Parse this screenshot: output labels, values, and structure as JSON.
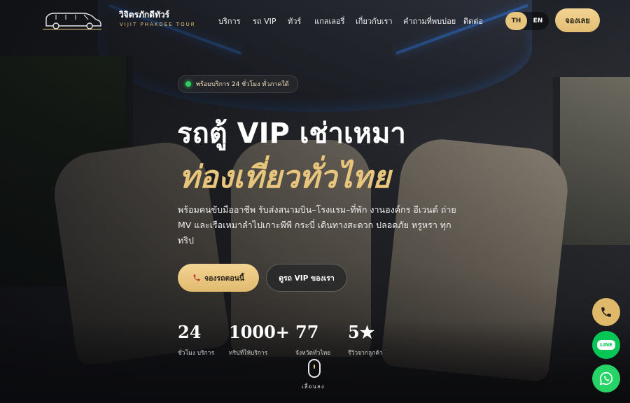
{
  "brand": {
    "name": "วิจิตรภักดีทัวร์",
    "tagline": "VIJIT PHAKDEE TOUR",
    "accent": "#e8c57c"
  },
  "nav": {
    "items": [
      "บริการ",
      "รถ VIP",
      "ทัวร์",
      "แกลเลอรี่",
      "เกี่ยวกับเรา",
      "คำถามที่พบบ่อย",
      "ติดต่อ"
    ]
  },
  "lang": {
    "th": "TH",
    "en": "EN",
    "selected": "TH"
  },
  "header": {
    "book_label": "จองเลย"
  },
  "hero": {
    "badge": "พร้อมบริการ 24 ชั่วโมง ทั่วภาคใต้",
    "title_line1": "รถตู้ VIP เช่าเหมา",
    "title_line2": "ท่องเที่ยวทั่วไทย",
    "description": "พร้อมคนขับมืออาชีพ รับส่งสนามบิน–โรงแรม–ที่พัก งานองค์กร อีเวนต์ ถ่าย MV และเรือเหมาลำไปเกาะพีพี กระบี่ เดินทางสะดวก ปลอดภัย หรูหรา ทุกทริป",
    "primary_button": "จองรถตอนนี้",
    "secondary_button": "ดูรถ VIP ของเรา"
  },
  "stats": [
    {
      "value": "24",
      "label": "ชั่วโมง บริการ"
    },
    {
      "value": "1000+",
      "label": "ทริปที่ให้บริการ"
    },
    {
      "value": "77",
      "label": "จังหวัดทั่วไทย"
    },
    {
      "value": "5★",
      "label": "รีวิวจากลูกค้า"
    }
  ],
  "scroll": {
    "label": "เลื่อนลง"
  },
  "floating": {
    "line_label": "LINE",
    "colors": {
      "phone": "#dfb86a",
      "line": "#06c755",
      "whatsapp": "#25d366"
    }
  },
  "icons": {
    "logo": "van-logo-icon",
    "badge": "status-dot-icon",
    "primary_button": "phone-icon",
    "fab_phone": "phone-icon",
    "fab_line": "line-icon",
    "fab_whatsapp": "whatsapp-icon"
  }
}
